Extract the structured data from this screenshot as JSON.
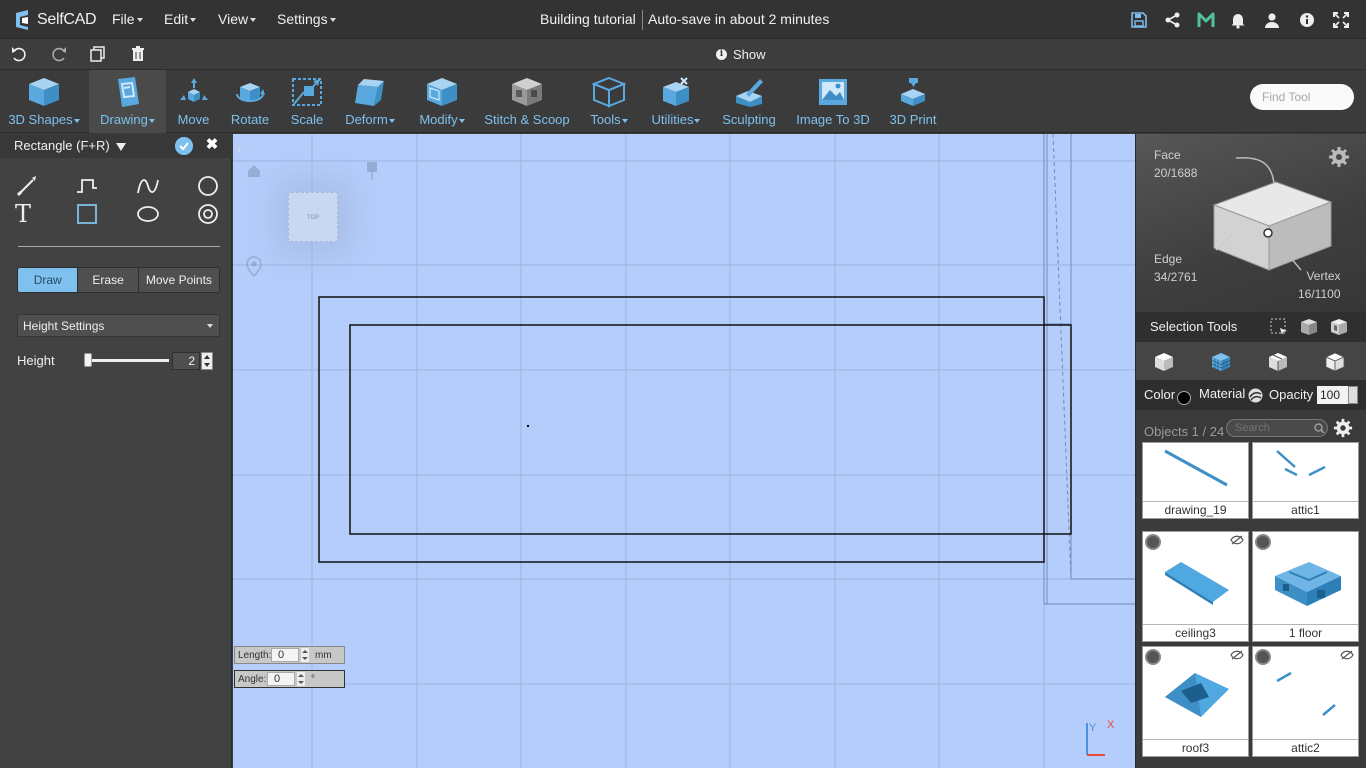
{
  "app": {
    "logo_text": "SelfCAD",
    "menus": [
      "File",
      "Edit",
      "View",
      "Settings"
    ],
    "project_title": "Building tutorial",
    "autosave": "Auto-save in about 2 minutes"
  },
  "toolbar2": {
    "show_label": "Show"
  },
  "tools": [
    {
      "label": "3D Shapes",
      "caret": true
    },
    {
      "label": "Drawing",
      "caret": true,
      "active": true
    },
    {
      "label": "Move",
      "caret": false
    },
    {
      "label": "Rotate",
      "caret": false
    },
    {
      "label": "Scale",
      "caret": false
    },
    {
      "label": "Deform",
      "caret": true
    },
    {
      "label": "Modify",
      "caret": true
    },
    {
      "label": "Stitch & Scoop",
      "caret": false
    },
    {
      "label": "Tools",
      "caret": true
    },
    {
      "label": "Utilities",
      "caret": true
    },
    {
      "label": "Sculpting",
      "caret": false
    },
    {
      "label": "Image To 3D",
      "caret": false
    },
    {
      "label": "3D Print",
      "caret": false
    }
  ],
  "find_tool_placeholder": "Find Tool",
  "left_panel": {
    "title": "Rectangle (F+R)",
    "text_tool_glyph": "T",
    "modes": [
      "Draw",
      "Erase",
      "Move Points"
    ],
    "active_mode": "Draw",
    "height_settings_label": "Height Settings",
    "height_label": "Height",
    "height_value": "2",
    "height_slider_fraction": 0.02
  },
  "viewport": {
    "viewcube_label": "TOP",
    "length_label": "Length:",
    "length_value": "0",
    "length_unit": "mm",
    "angle_label": "Angle:",
    "angle_value": "0",
    "angle_unit": "°",
    "axis_x": "X",
    "axis_y": "Y"
  },
  "right_panel": {
    "face_label": "Face",
    "face_count": "20/1688",
    "edge_label": "Edge",
    "edge_count": "34/2761",
    "vertex_label": "Vertex",
    "vertex_count": "16/1100",
    "selection_tools_label": "Selection Tools",
    "color_label": "Color",
    "material_label": "Material",
    "opacity_label": "Opacity",
    "opacity_value": "100",
    "objects_count": "Objects 1 / 24",
    "search_placeholder": "Search",
    "objects": [
      "drawing_19",
      "attic1",
      "ceiling3",
      "1 floor",
      "roof3",
      "attic2"
    ]
  },
  "colors": {
    "accent": "#7ec0ee",
    "viewport_bg": "#b4cdfb",
    "model_blue": "#3d8fc6"
  }
}
